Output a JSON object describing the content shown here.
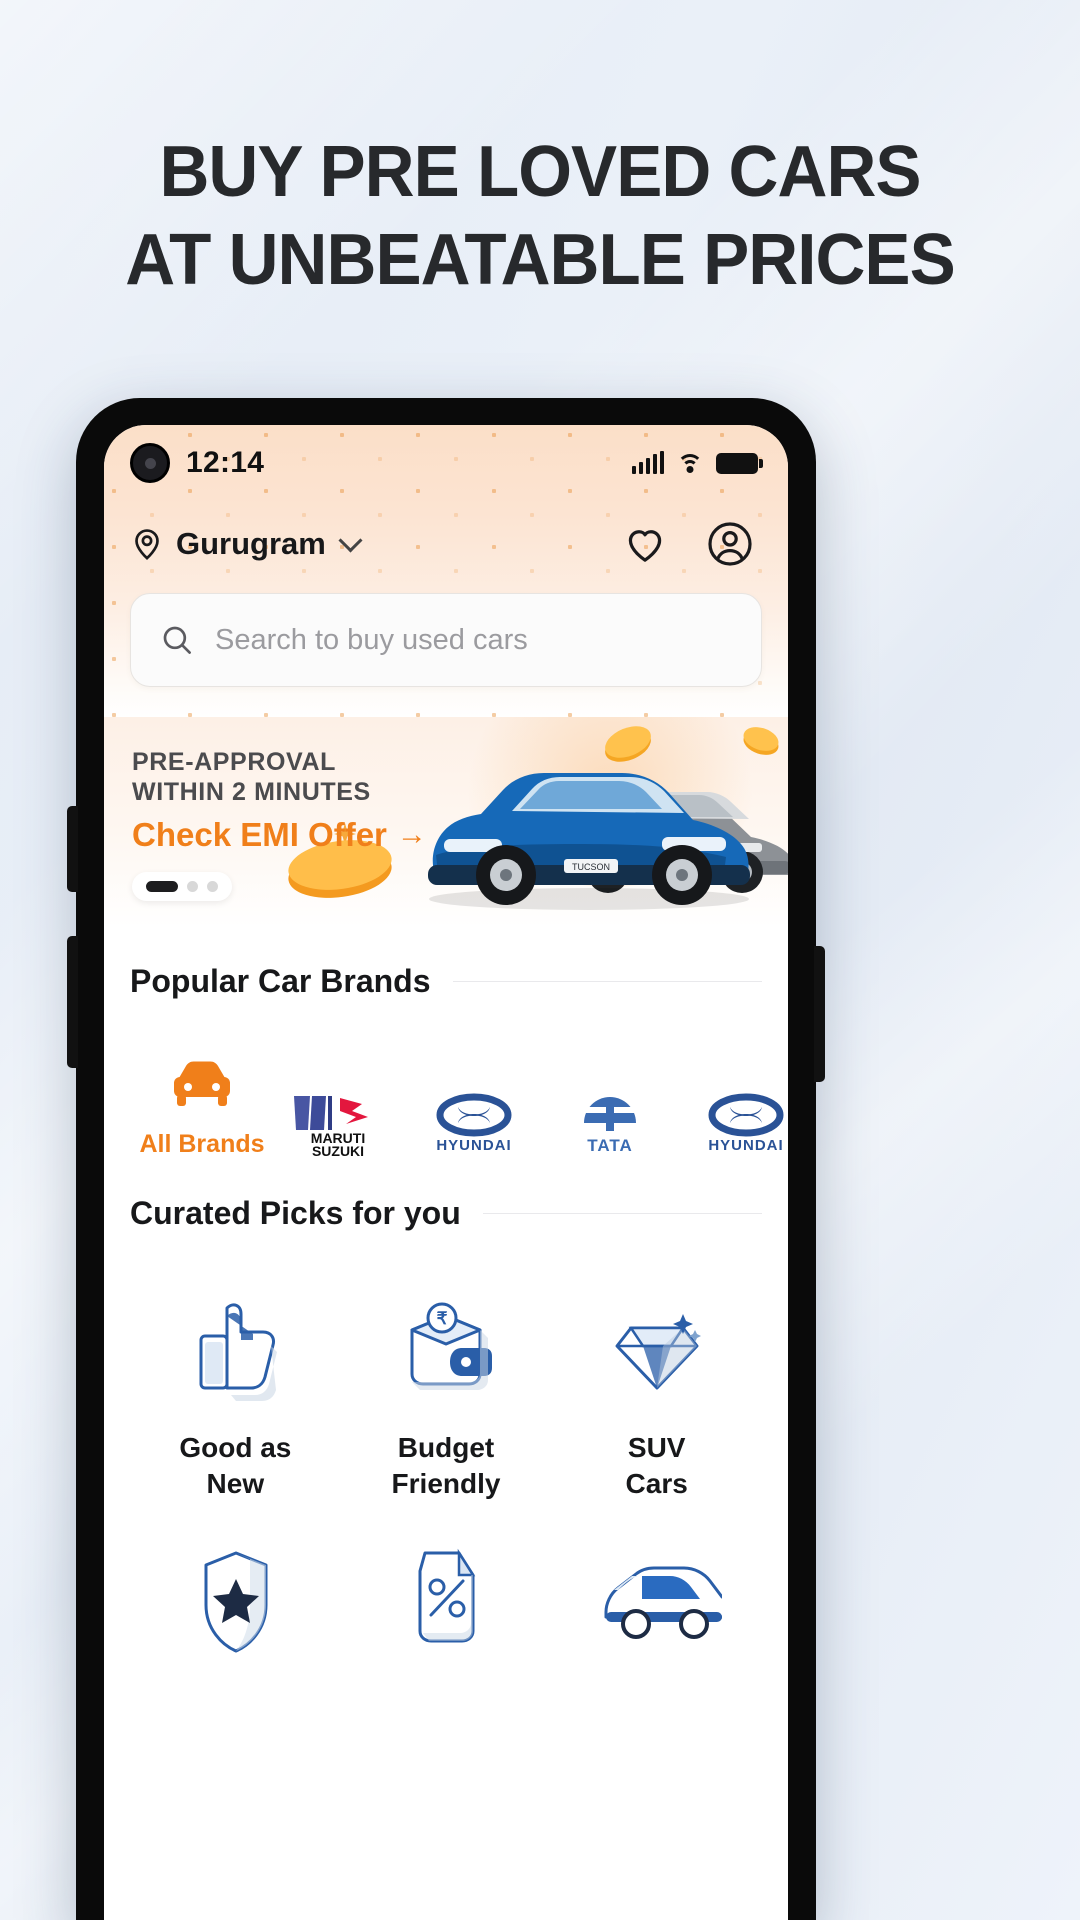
{
  "poster": {
    "headline_line1": "BUY PRE LOVED CARS",
    "headline_line2": "AT UNBEATABLE PRICES",
    "bg_color": "#e7eef7",
    "headline_color": "#27292c"
  },
  "statusbar": {
    "time": "12:14",
    "signal_icon": "cellular-signal-icon",
    "wifi_icon": "wifi-icon",
    "battery_icon": "battery-full-icon"
  },
  "header": {
    "location_pin_icon": "location-pin-icon",
    "location": "Gurugram",
    "chevron_icon": "chevron-down-icon",
    "wishlist_icon": "heart-icon",
    "profile_icon": "user-account-icon",
    "accent_color": "#f07f1a",
    "background_color": "#fbdfc8"
  },
  "search": {
    "placeholder": "Search to buy used cars",
    "icon": "search-icon"
  },
  "banner": {
    "line1": "PRE-APPROVAL",
    "line2": "WITHIN 2 MINUTES",
    "cta": "Check EMI Offer",
    "cta_arrow": "→",
    "cta_color": "#f07f1a",
    "carousel": {
      "total": 3,
      "active": 1
    }
  },
  "brands_section": {
    "title": "Popular Car Brands",
    "items": [
      {
        "label": "All Brands",
        "logo": "car-front-icon",
        "color": "#f07f1a"
      },
      {
        "label": "",
        "logo": "maruti-suzuki-logo",
        "color": "#1a1a1a"
      },
      {
        "label": "",
        "logo": "hyundai-logo",
        "color": "#2a5296"
      },
      {
        "label": "",
        "logo": "tata-logo",
        "color": "#3b6cb3"
      },
      {
        "label": "",
        "logo": "hyundai-logo",
        "color": "#2a5296"
      }
    ]
  },
  "curated_section": {
    "title": "Curated Picks for you",
    "items": [
      {
        "label": "Good as\nNew",
        "line1": "Good as",
        "line2": "New",
        "icon": "thumbs-up-icon"
      },
      {
        "label": "Budget\nFriendly",
        "line1": "Budget",
        "line2": "Friendly",
        "icon": "wallet-rupee-icon"
      },
      {
        "label": "SUV\nCars",
        "line1": "SUV",
        "line2": "Cars",
        "icon": "diamond-icon"
      },
      {
        "label": "",
        "line1": "",
        "line2": "",
        "icon": "shield-star-icon"
      },
      {
        "label": "",
        "line1": "",
        "line2": "",
        "icon": "discount-tag-icon"
      },
      {
        "label": "",
        "line1": "",
        "line2": "",
        "icon": "van-icon"
      }
    ]
  }
}
